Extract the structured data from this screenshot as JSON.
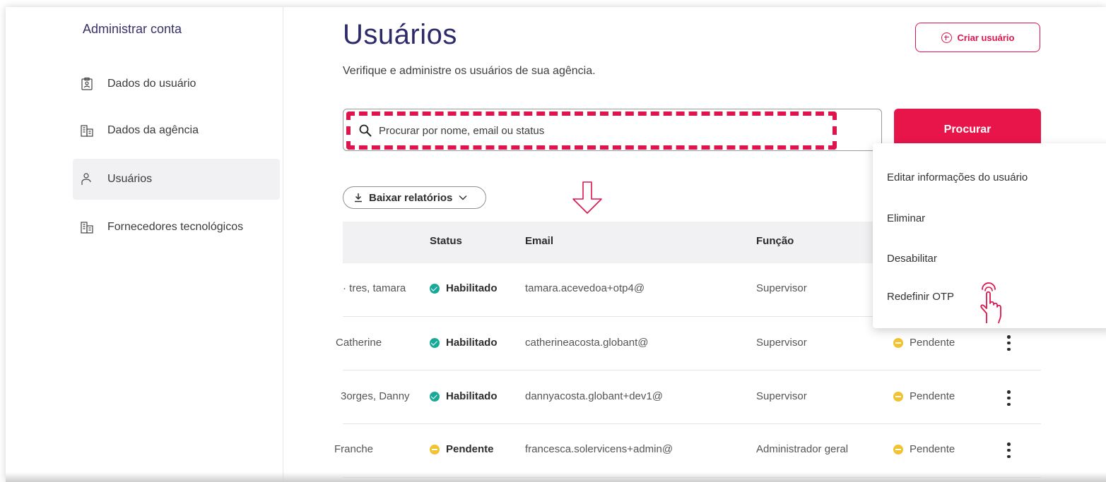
{
  "sidebar": {
    "title": "Administrar conta",
    "items": [
      {
        "label": "Dados do usuário",
        "icon": "user-badge-icon"
      },
      {
        "label": "Dados da agência",
        "icon": "building-icon"
      },
      {
        "label": "Usuários",
        "icon": "person-icon"
      },
      {
        "label": "Fornecedores tecnológicos",
        "icon": "building-icon"
      }
    ]
  },
  "header": {
    "title": "Usuários",
    "subtitle": "Verifique e administre os usuários de sua agência.",
    "create_label": "Criar usuário"
  },
  "search": {
    "placeholder": "Procurar por nome, email ou status",
    "button_label": "Procurar"
  },
  "download": {
    "label": "Baixar relatórios"
  },
  "table": {
    "columns": [
      "Status",
      "Email",
      "Função"
    ],
    "rows": [
      {
        "name": "· tres, tamara",
        "status": "Habilitado",
        "email": "tamara.acevedoa+otp4@",
        "role": "Supervisor",
        "otp": ""
      },
      {
        "name": "Catherine",
        "status": "Habilitado",
        "email": "catherineacosta.globant@",
        "role": "Supervisor",
        "otp": "Pendente"
      },
      {
        "name": "3orges, Danny",
        "status": "Habilitado",
        "email": "dannyacosta.globant+dev1@",
        "role": "Supervisor",
        "otp": "Pendente"
      },
      {
        "name": "Franche",
        "status": "Pendente",
        "email": "francesca.solervicens+admin@",
        "role": "Administrador geral",
        "otp": "Pendente"
      }
    ]
  },
  "menu": {
    "items": [
      "Editar informações do usuário",
      "Eliminar",
      "Desabilitar",
      "Redefinir OTP"
    ]
  },
  "colors": {
    "accent": "#e8154b",
    "title": "#2d2a6b",
    "ok": "#19a999",
    "pending": "#f2c230"
  }
}
